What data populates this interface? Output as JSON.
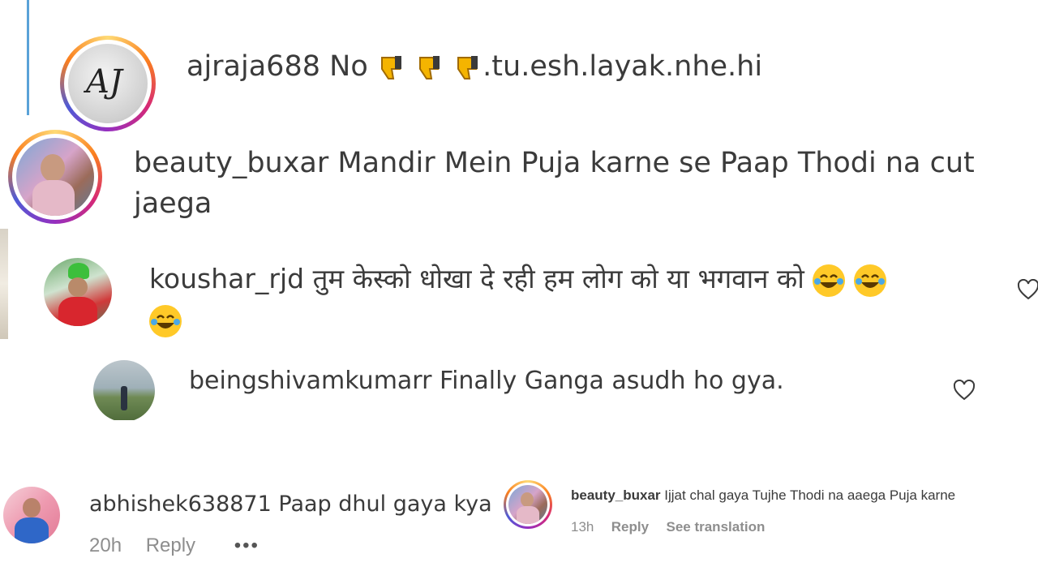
{
  "comments": {
    "c1": {
      "username": "ajraja688",
      "text": "No",
      "emojis": [
        "thumbs-down",
        "thumbs-down",
        "thumbs-down"
      ],
      "text_after": ".tu.esh.layak.nhe.hi",
      "avatar_initials": "AJ"
    },
    "c2": {
      "username": "beauty_buxar",
      "line1": "Mandir Mein Puja karne se Paap Thodi na cut",
      "line2": "jaega"
    },
    "c3": {
      "username": "koushar_rjd",
      "text": "तुम केस्को धोखा दे रही हम लोग को या भगवान को",
      "emojis": [
        "face-with-tears-of-joy",
        "face-with-tears-of-joy",
        "face-with-tears-of-joy"
      ]
    },
    "c4": {
      "username": "beingshivamkumarr",
      "text": "Finally Ganga asudh ho gya."
    },
    "c5": {
      "username": "abhishek638871",
      "text": "Paap dhul gaya kya",
      "time": "20h",
      "reply_label": "Reply",
      "more_label": "•••"
    },
    "c6": {
      "username": "beauty_buxar",
      "text": "Ijjat chal gaya Tujhe Thodi na aaega Puja karne",
      "time": "13h",
      "reply_label": "Reply",
      "translation_label": "See translation"
    }
  },
  "colors": {
    "text": "#3b3b3b",
    "meta": "#8e8e8e",
    "divider": "#5aa2d8"
  },
  "icons": [
    "heart-icon",
    "thumbs-down-icon",
    "face-with-tears-of-joy-icon"
  ]
}
